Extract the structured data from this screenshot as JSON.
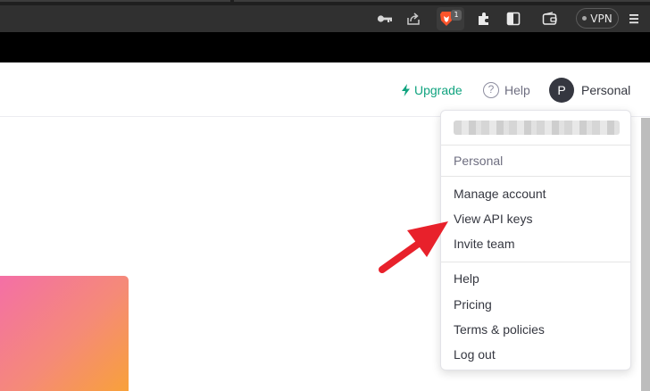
{
  "browser": {
    "vpn_label": "VPN",
    "shields_badge": "1",
    "icons": [
      "key-icon",
      "share-icon",
      "brave-shields-icon",
      "extensions-icon",
      "sidebar-icon",
      "wallet-icon",
      "vpn-icon",
      "menu-icon"
    ]
  },
  "header": {
    "upgrade_label": "Upgrade",
    "help_label": "Help",
    "avatar_initial": "P",
    "account_label": "Personal"
  },
  "dropdown": {
    "org_label": "Personal",
    "account_items": [
      "Manage account",
      "View API keys",
      "Invite team"
    ],
    "support_items": [
      "Help",
      "Pricing",
      "Terms & policies",
      "Log out"
    ]
  },
  "colors": {
    "brand_green": "#10a37f",
    "annotation_arrow": "#e8212b",
    "text_dark": "#353740",
    "text_muted": "#6e6e80"
  }
}
